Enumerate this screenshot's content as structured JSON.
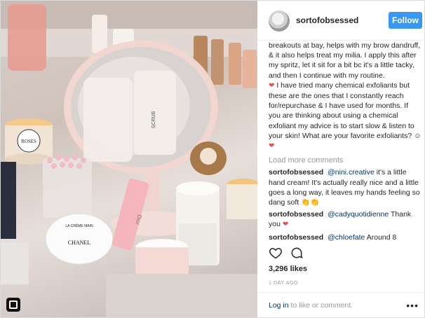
{
  "post": {
    "username": "sortofobsessed",
    "follow_label": "Follow",
    "caption_part1": "breakouts at bay, helps with my brow dandruff, & it also helps treat my milia. I apply this after my spritz, let it sit for a bit bc it's a little tacky, and then I continue with my routine.",
    "caption_part2": "I have tried many chemical exfoliants but these are the ones that I constantly reach for/repurchase & I have used for months. If you are thinking about using a chemical exfoliant my advice is to start slow & listen to your skin! What are your favorite exfoliants?",
    "load_more": "Load more comments",
    "comments": [
      {
        "user": "sortofobsessed",
        "mention": "@nini.creative",
        "text": "it's a little hand cream! It's actually really nice and a little goes a long way, it leaves my hands feeling so dang soft"
      },
      {
        "user": "sortofobsessed",
        "mention": "@cadyquotidienne",
        "text": "Thank you"
      },
      {
        "user": "sortofobsessed",
        "mention": "@chloefate",
        "text": "Around 8"
      }
    ],
    "likes": "3,296 likes",
    "time_ago": "1 DAY AGO",
    "login_link": "Log in",
    "login_rest": "to like or comment.",
    "more_dots": "•••"
  },
  "photo": {
    "items": [
      "DIPTYQUE candle",
      "CHANEL La Crème Main",
      "Dior lip glow",
      "Kiehl's dispenser",
      "mirror"
    ],
    "dior_text": "Dior",
    "chanel_text": "CHANEL",
    "chanel_sub": "LA CRÈME MAIN",
    "diptyque_text": "ROSES",
    "mirror_text": "SCRUB"
  },
  "icons": {
    "heart": "heart-icon",
    "comment": "comment-icon",
    "instagram": "instagram-icon"
  },
  "colors": {
    "accent": "#3897f0",
    "heart": "#ed4956",
    "link": "#003569",
    "muted": "#999999"
  }
}
